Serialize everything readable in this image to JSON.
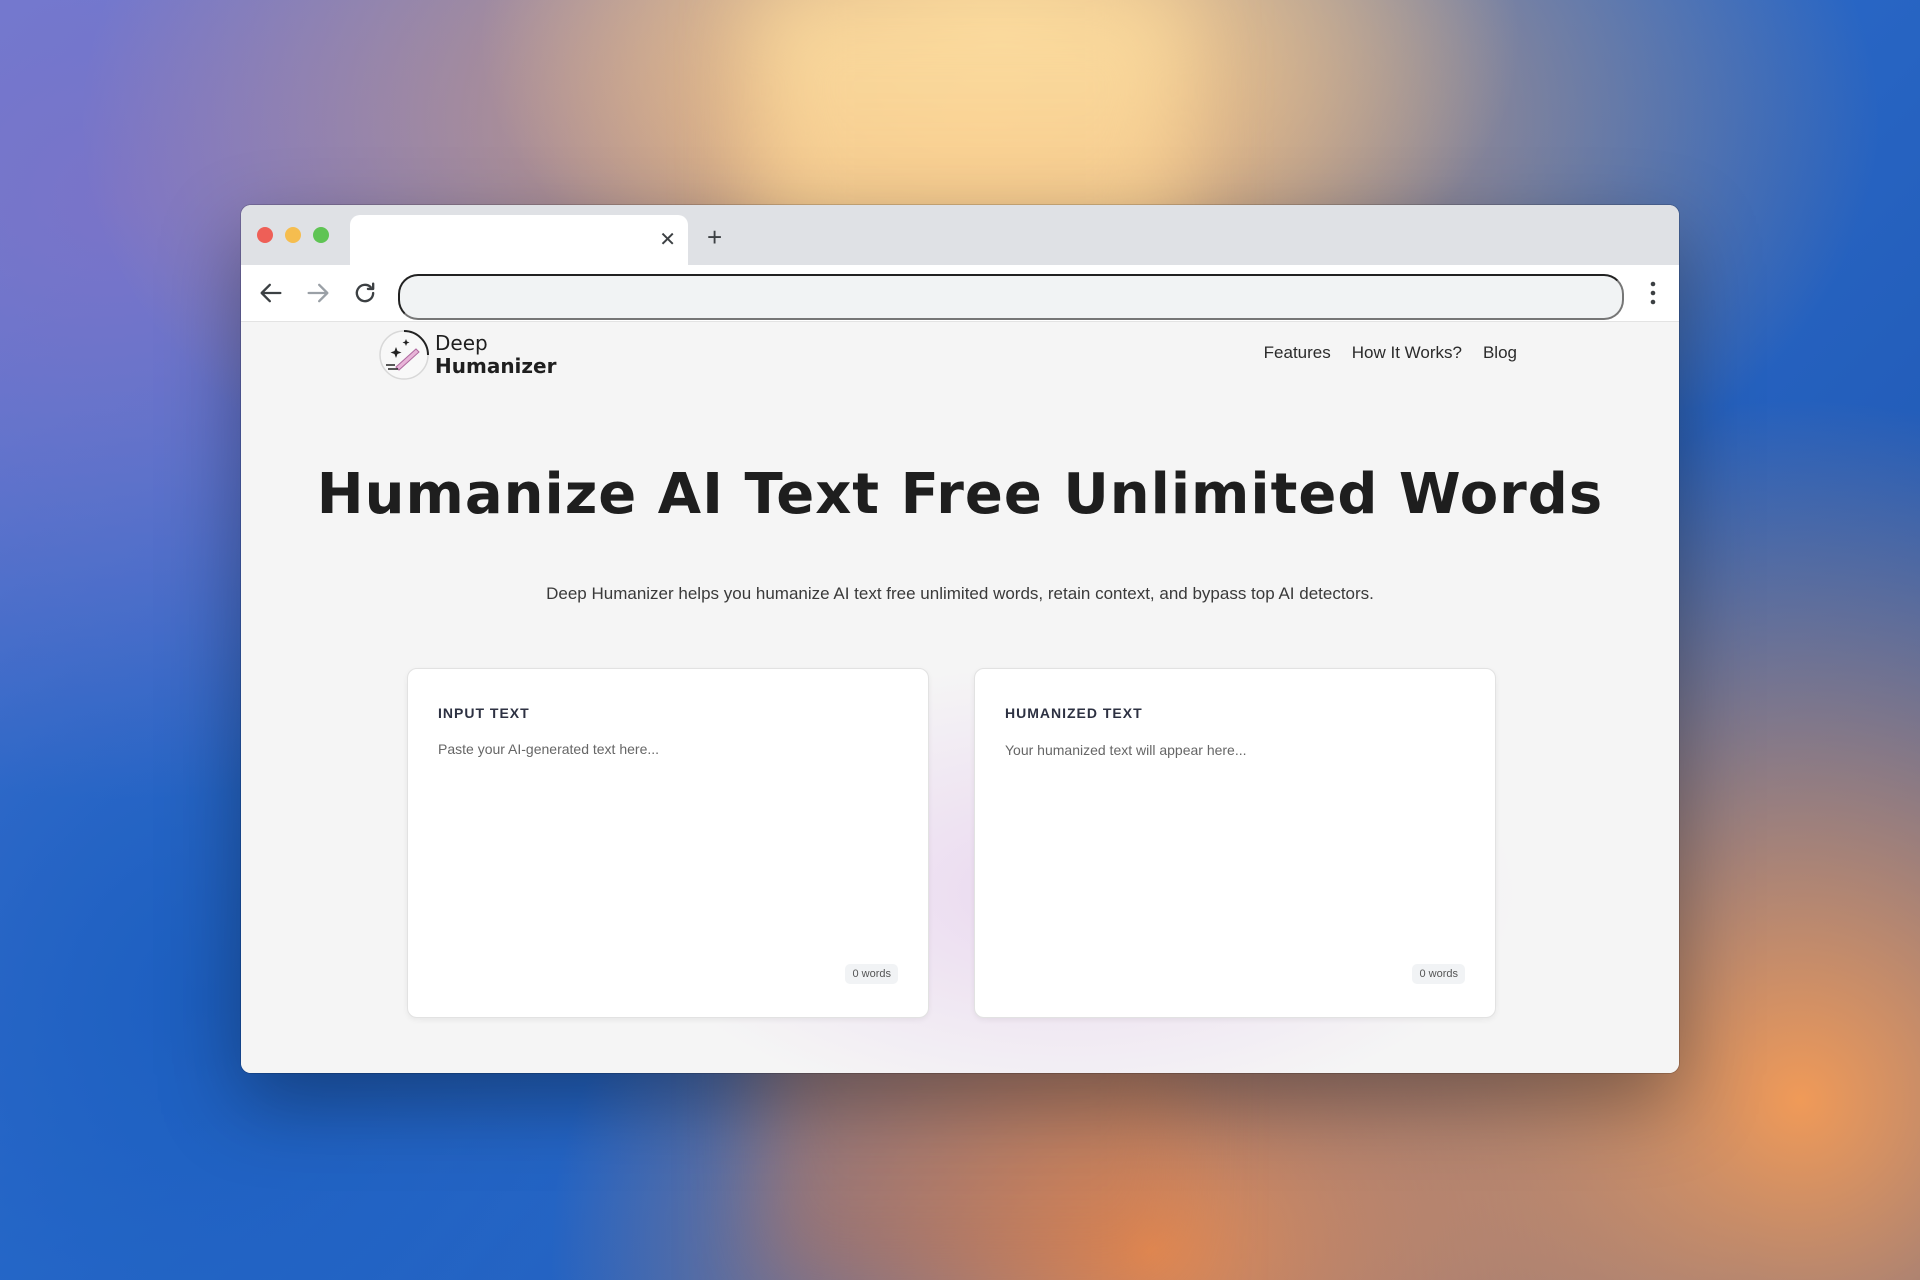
{
  "browser": {
    "tab": {
      "title": "",
      "close_glyph": "✕"
    },
    "new_tab_glyph": "+",
    "address": {
      "value": "",
      "placeholder": ""
    },
    "icons": [
      "back-arrow-icon",
      "forward-arrow-icon",
      "reload-icon",
      "more-vert-icon"
    ]
  },
  "site": {
    "logo": {
      "line1": "Deep",
      "line2": "Humanizer"
    },
    "nav": [
      {
        "label": "Features"
      },
      {
        "label": "How It Works?"
      },
      {
        "label": "Blog"
      }
    ],
    "hero": {
      "title": "Humanize AI Text Free Unlimited Words",
      "subtitle": "Deep Humanizer helps you humanize AI text free unlimited words, retain context, and bypass top AI detectors."
    },
    "input_card": {
      "label": "INPUT TEXT",
      "value": "",
      "placeholder": "Paste your AI-generated text here...",
      "word_count": "0 words"
    },
    "output_card": {
      "label": "HUMANIZED TEXT",
      "placeholder": "Your humanized text will appear here...",
      "word_count": "0 words"
    }
  },
  "colors": {
    "traffic_red": "#ee5f57",
    "traffic_yellow": "#f5bd4f",
    "traffic_green": "#5fc454",
    "page_bg": "#f5f5f5",
    "title_text": "#1e1e1e"
  }
}
